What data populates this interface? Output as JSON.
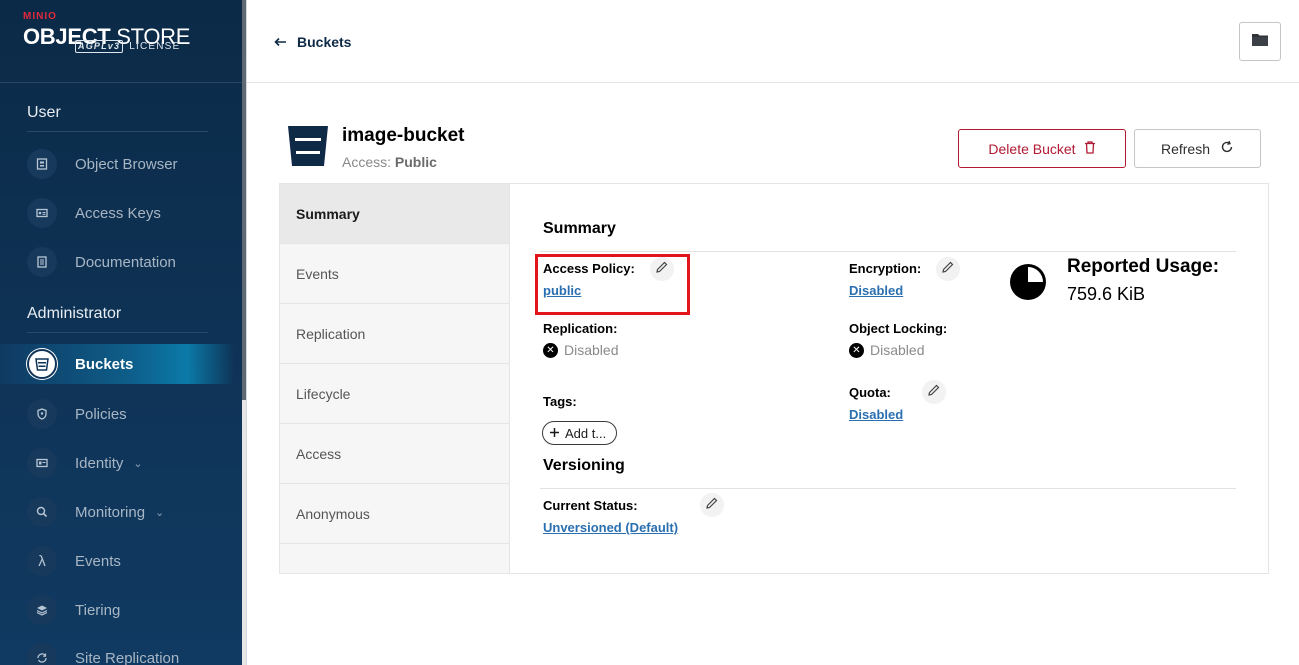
{
  "app": {
    "brand_small": "MINIO",
    "title_bold": "OBJECT",
    "title_light": " STORE",
    "license_badge": "AGPLv3",
    "license_text": "LICENSE"
  },
  "sidebar": {
    "user_section": "User",
    "user_items": [
      {
        "label": "Object Browser",
        "icon": "object-browser-icon"
      },
      {
        "label": "Access Keys",
        "icon": "access-keys-icon"
      },
      {
        "label": "Documentation",
        "icon": "documentation-icon"
      }
    ],
    "admin_section": "Administrator",
    "admin_items": [
      {
        "label": "Buckets",
        "icon": "bucket-icon",
        "active": true
      },
      {
        "label": "Policies",
        "icon": "policy-shield-icon"
      },
      {
        "label": "Identity",
        "icon": "identity-icon",
        "has_caret": true
      },
      {
        "label": "Monitoring",
        "icon": "monitoring-icon",
        "has_caret": true
      },
      {
        "label": "Events",
        "icon": "lambda-icon"
      },
      {
        "label": "Tiering",
        "icon": "tiering-layers-icon"
      },
      {
        "label": "Site Replication",
        "icon": "site-replication-icon"
      }
    ]
  },
  "header": {
    "back_label": "Buckets"
  },
  "bucket": {
    "name": "image-bucket",
    "access_label": "Access:",
    "access_value": "Public",
    "delete_label": "Delete Bucket",
    "refresh_label": "Refresh"
  },
  "tabs": [
    "Summary",
    "Events",
    "Replication",
    "Lifecycle",
    "Access",
    "Anonymous"
  ],
  "summary": {
    "title": "Summary",
    "access_policy_label": "Access Policy:",
    "access_policy_value": "public",
    "encryption_label": "Encryption:",
    "encryption_value": "Disabled",
    "replication_label": "Replication:",
    "replication_value": "Disabled",
    "object_locking_label": "Object Locking:",
    "object_locking_value": "Disabled",
    "tags_label": "Tags:",
    "add_tag_label": "Add t...",
    "quota_label": "Quota:",
    "quota_value": "Disabled",
    "usage_title": "Reported Usage:",
    "usage_value": "759.6 KiB"
  },
  "versioning": {
    "title": "Versioning",
    "status_label": "Current Status:",
    "status_value": "Unversioned (Default)"
  },
  "colors": {
    "sidebar_bg": "#0f3458",
    "accent_red": "#b01a33",
    "link_blue": "#2a6fb0",
    "highlight_red": "#e3141c"
  }
}
